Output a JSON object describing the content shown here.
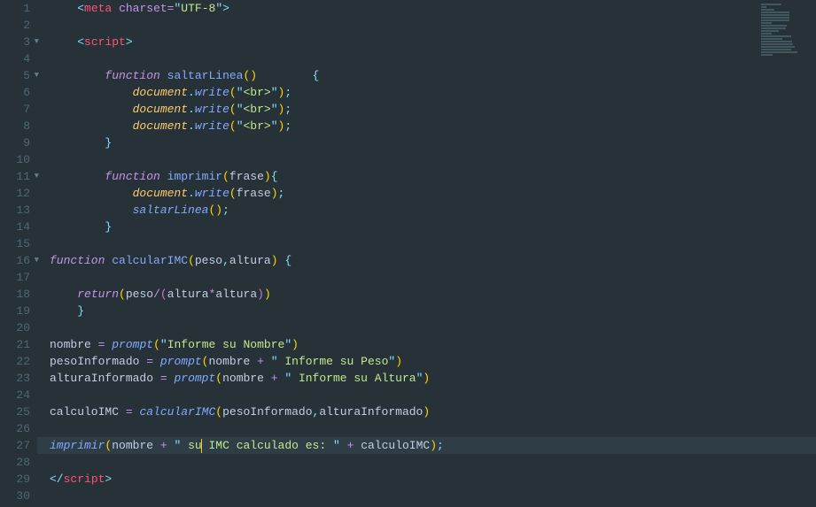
{
  "language": "html-js",
  "active_line": 27,
  "cursor": {
    "line": 27,
    "after_char": 22
  },
  "lines": [
    {
      "n": 1,
      "fold": "",
      "tokens": [
        [
          "txt",
          "    "
        ],
        [
          "punc",
          "<"
        ],
        [
          "tag",
          "meta"
        ],
        [
          "txt",
          " "
        ],
        [
          "attr",
          "charset"
        ],
        [
          "eq",
          "="
        ],
        [
          "punc",
          "\""
        ],
        [
          "str",
          "UTF-8"
        ],
        [
          "punc",
          "\""
        ],
        [
          "punc",
          ">"
        ]
      ]
    },
    {
      "n": 2,
      "fold": "",
      "tokens": []
    },
    {
      "n": 3,
      "fold": "▼",
      "tokens": [
        [
          "txt",
          "    "
        ],
        [
          "punc",
          "<"
        ],
        [
          "tag",
          "script"
        ],
        [
          "punc",
          ">"
        ]
      ]
    },
    {
      "n": 4,
      "fold": "",
      "tokens": []
    },
    {
      "n": 5,
      "fold": "▼",
      "tokens": [
        [
          "txt",
          "        "
        ],
        [
          "kw",
          "function"
        ],
        [
          "txt",
          " "
        ],
        [
          "fn",
          "saltarLinea"
        ],
        [
          "paren",
          "()"
        ],
        [
          "txt",
          "        "
        ],
        [
          "punc",
          "{"
        ]
      ]
    },
    {
      "n": 6,
      "fold": "",
      "tokens": [
        [
          "txt",
          "            "
        ],
        [
          "obj",
          "document"
        ],
        [
          "punc",
          "."
        ],
        [
          "fni",
          "write"
        ],
        [
          "paren",
          "("
        ],
        [
          "punc",
          "\""
        ],
        [
          "str",
          "<br>"
        ],
        [
          "punc",
          "\""
        ],
        [
          "paren",
          ")"
        ],
        [
          "punc",
          ";"
        ]
      ]
    },
    {
      "n": 7,
      "fold": "",
      "tokens": [
        [
          "txt",
          "            "
        ],
        [
          "obj",
          "document"
        ],
        [
          "punc",
          "."
        ],
        [
          "fni",
          "write"
        ],
        [
          "paren",
          "("
        ],
        [
          "punc",
          "\""
        ],
        [
          "str",
          "<br>"
        ],
        [
          "punc",
          "\""
        ],
        [
          "paren",
          ")"
        ],
        [
          "punc",
          ";"
        ]
      ]
    },
    {
      "n": 8,
      "fold": "",
      "tokens": [
        [
          "txt",
          "            "
        ],
        [
          "obj",
          "document"
        ],
        [
          "punc",
          "."
        ],
        [
          "fni",
          "write"
        ],
        [
          "paren",
          "("
        ],
        [
          "punc",
          "\""
        ],
        [
          "str",
          "<br>"
        ],
        [
          "punc",
          "\""
        ],
        [
          "paren",
          ")"
        ],
        [
          "punc",
          ";"
        ]
      ]
    },
    {
      "n": 9,
      "fold": "",
      "tokens": [
        [
          "txt",
          "        "
        ],
        [
          "punc",
          "}"
        ]
      ]
    },
    {
      "n": 10,
      "fold": "",
      "tokens": []
    },
    {
      "n": 11,
      "fold": "▼",
      "tokens": [
        [
          "txt",
          "        "
        ],
        [
          "kw",
          "function"
        ],
        [
          "txt",
          " "
        ],
        [
          "fn",
          "imprimir"
        ],
        [
          "paren",
          "("
        ],
        [
          "id",
          "frase"
        ],
        [
          "paren",
          ")"
        ],
        [
          "punc",
          "{"
        ]
      ]
    },
    {
      "n": 12,
      "fold": "",
      "tokens": [
        [
          "txt",
          "            "
        ],
        [
          "obj",
          "document"
        ],
        [
          "punc",
          "."
        ],
        [
          "fni",
          "write"
        ],
        [
          "paren",
          "("
        ],
        [
          "id",
          "frase"
        ],
        [
          "paren",
          ")"
        ],
        [
          "punc",
          ";"
        ]
      ]
    },
    {
      "n": 13,
      "fold": "",
      "tokens": [
        [
          "txt",
          "            "
        ],
        [
          "fni",
          "saltarLinea"
        ],
        [
          "paren",
          "()"
        ],
        [
          "punc",
          ";"
        ]
      ]
    },
    {
      "n": 14,
      "fold": "",
      "tokens": [
        [
          "txt",
          "        "
        ],
        [
          "punc",
          "}"
        ]
      ]
    },
    {
      "n": 15,
      "fold": "",
      "tokens": []
    },
    {
      "n": 16,
      "fold": "▼",
      "tokens": [
        [
          "kw",
          "function"
        ],
        [
          "txt",
          " "
        ],
        [
          "fn",
          "calcularIMC"
        ],
        [
          "paren",
          "("
        ],
        [
          "id",
          "peso"
        ],
        [
          "punc",
          ","
        ],
        [
          "id",
          "altura"
        ],
        [
          "paren",
          ")"
        ],
        [
          "txt",
          " "
        ],
        [
          "punc",
          "{"
        ]
      ]
    },
    {
      "n": 17,
      "fold": "",
      "tokens": []
    },
    {
      "n": 18,
      "fold": "",
      "tokens": [
        [
          "txt",
          "    "
        ],
        [
          "kw",
          "return"
        ],
        [
          "paren",
          "("
        ],
        [
          "id",
          "peso"
        ],
        [
          "op",
          "/"
        ],
        [
          "paren2",
          "("
        ],
        [
          "id",
          "altura"
        ],
        [
          "op",
          "*"
        ],
        [
          "id",
          "altura"
        ],
        [
          "paren2",
          ")"
        ],
        [
          "paren",
          ")"
        ]
      ]
    },
    {
      "n": 19,
      "fold": "",
      "tokens": [
        [
          "txt",
          "    "
        ],
        [
          "punc",
          "}"
        ]
      ]
    },
    {
      "n": 20,
      "fold": "",
      "tokens": []
    },
    {
      "n": 21,
      "fold": "",
      "tokens": [
        [
          "id",
          "nombre"
        ],
        [
          "txt",
          " "
        ],
        [
          "op",
          "="
        ],
        [
          "txt",
          " "
        ],
        [
          "fni",
          "prompt"
        ],
        [
          "paren",
          "("
        ],
        [
          "punc",
          "\""
        ],
        [
          "str",
          "Informe su Nombre"
        ],
        [
          "punc",
          "\""
        ],
        [
          "paren",
          ")"
        ]
      ]
    },
    {
      "n": 22,
      "fold": "",
      "tokens": [
        [
          "id",
          "pesoInformado"
        ],
        [
          "txt",
          " "
        ],
        [
          "op",
          "="
        ],
        [
          "txt",
          " "
        ],
        [
          "fni",
          "prompt"
        ],
        [
          "paren",
          "("
        ],
        [
          "id",
          "nombre"
        ],
        [
          "txt",
          " "
        ],
        [
          "op",
          "+"
        ],
        [
          "txt",
          " "
        ],
        [
          "punc",
          "\""
        ],
        [
          "str",
          " Informe su Peso"
        ],
        [
          "punc",
          "\""
        ],
        [
          "paren",
          ")"
        ]
      ]
    },
    {
      "n": 23,
      "fold": "",
      "tokens": [
        [
          "id",
          "alturaInformado"
        ],
        [
          "txt",
          " "
        ],
        [
          "op",
          "="
        ],
        [
          "txt",
          " "
        ],
        [
          "fni",
          "prompt"
        ],
        [
          "paren",
          "("
        ],
        [
          "id",
          "nombre"
        ],
        [
          "txt",
          " "
        ],
        [
          "op",
          "+"
        ],
        [
          "txt",
          " "
        ],
        [
          "punc",
          "\""
        ],
        [
          "str",
          " Informe su Altura"
        ],
        [
          "punc",
          "\""
        ],
        [
          "paren",
          ")"
        ]
      ]
    },
    {
      "n": 24,
      "fold": "",
      "tokens": []
    },
    {
      "n": 25,
      "fold": "",
      "tokens": [
        [
          "id",
          "calculoIMC"
        ],
        [
          "txt",
          " "
        ],
        [
          "op",
          "="
        ],
        [
          "txt",
          " "
        ],
        [
          "fni",
          "calcularIMC"
        ],
        [
          "paren",
          "("
        ],
        [
          "id",
          "pesoInformado"
        ],
        [
          "punc",
          ","
        ],
        [
          "id",
          "alturaInformado"
        ],
        [
          "paren",
          ")"
        ]
      ]
    },
    {
      "n": 26,
      "fold": "",
      "tokens": []
    },
    {
      "n": 27,
      "fold": "",
      "tokens": [
        [
          "fni",
          "imprimir"
        ],
        [
          "paren",
          "("
        ],
        [
          "id",
          "nombre"
        ],
        [
          "txt",
          " "
        ],
        [
          "op",
          "+"
        ],
        [
          "txt",
          " "
        ],
        [
          "punc",
          "\""
        ],
        [
          "str",
          " su IMC calculado es: "
        ],
        [
          "punc",
          "\""
        ],
        [
          "txt",
          " "
        ],
        [
          "op",
          "+"
        ],
        [
          "txt",
          " "
        ],
        [
          "id",
          "calculoIMC"
        ],
        [
          "paren",
          ")"
        ],
        [
          "punc",
          ";"
        ]
      ]
    },
    {
      "n": 28,
      "fold": "",
      "tokens": []
    },
    {
      "n": 29,
      "fold": "",
      "tokens": [
        [
          "punc",
          "</"
        ],
        [
          "tag",
          "script"
        ],
        [
          "punc",
          ">"
        ]
      ]
    },
    {
      "n": 30,
      "fold": "",
      "tokens": []
    }
  ]
}
